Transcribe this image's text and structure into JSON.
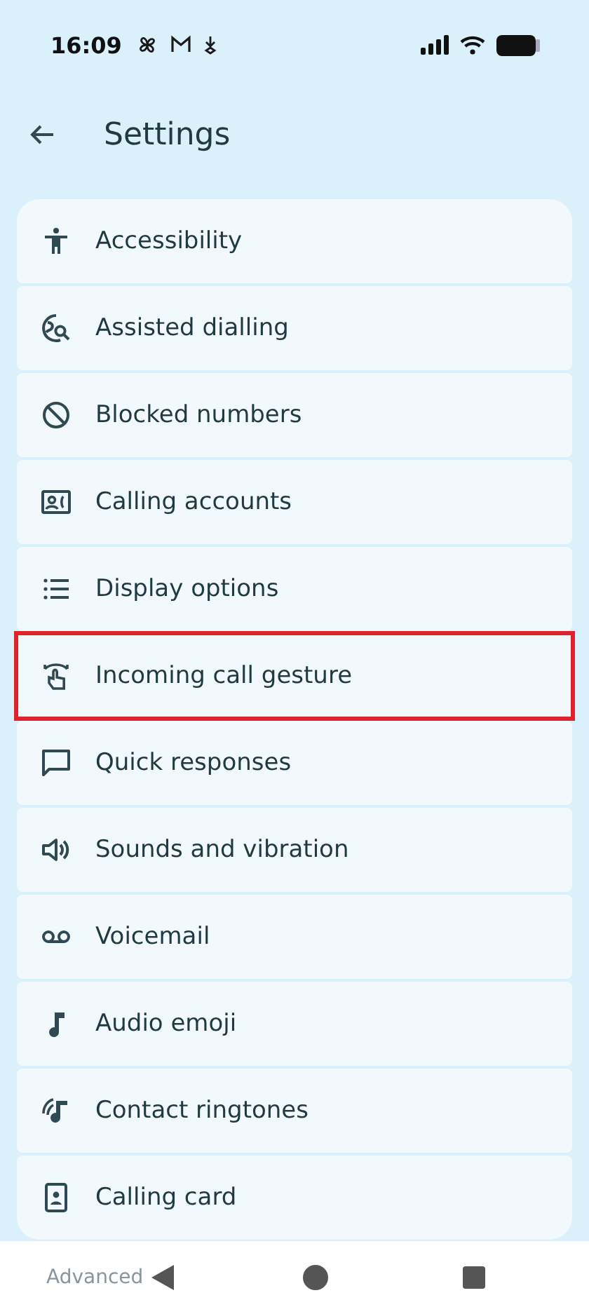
{
  "status_bar": {
    "time": "16:09"
  },
  "header": {
    "title": "Settings"
  },
  "items": [
    {
      "label": "Accessibility",
      "highlighted": false
    },
    {
      "label": "Assisted dialling",
      "highlighted": false
    },
    {
      "label": "Blocked numbers",
      "highlighted": false
    },
    {
      "label": "Calling accounts",
      "highlighted": false
    },
    {
      "label": "Display options",
      "highlighted": false
    },
    {
      "label": "Incoming call gesture",
      "highlighted": true
    },
    {
      "label": "Quick responses",
      "highlighted": false
    },
    {
      "label": "Sounds and vibration",
      "highlighted": false
    },
    {
      "label": "Voicemail",
      "highlighted": false
    },
    {
      "label": "Audio emoji",
      "highlighted": false
    },
    {
      "label": "Contact ringtones",
      "highlighted": false
    },
    {
      "label": "Calling card",
      "highlighted": false
    }
  ],
  "section_below": {
    "label": "Advanced"
  }
}
